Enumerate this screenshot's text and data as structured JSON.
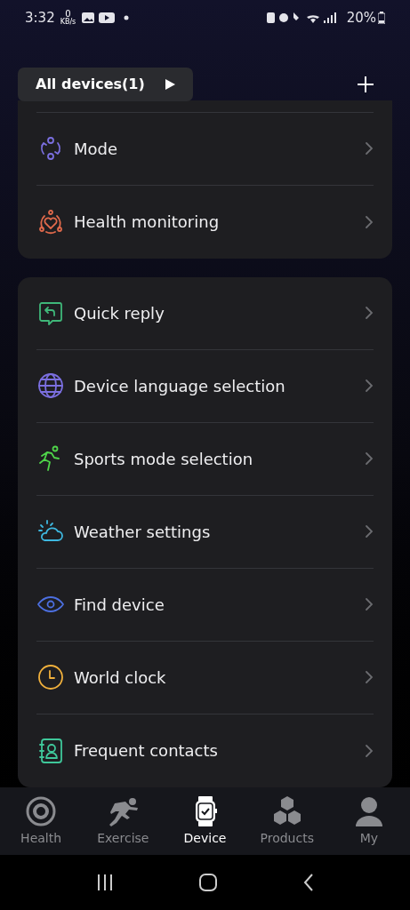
{
  "status_bar": {
    "time": "3:32",
    "net_speed": "0",
    "net_unit": "KB/s",
    "battery": "20%"
  },
  "header": {
    "devices_button": "All devices(1)"
  },
  "groups": [
    {
      "items": [
        {
          "label": "Mode"
        },
        {
          "label": "Health monitoring"
        }
      ]
    },
    {
      "items": [
        {
          "label": "Quick reply"
        },
        {
          "label": "Device language selection"
        },
        {
          "label": "Sports mode selection"
        },
        {
          "label": "Weather settings"
        },
        {
          "label": "Find device"
        },
        {
          "label": "World clock"
        },
        {
          "label": "Frequent contacts"
        }
      ]
    }
  ],
  "tabs": [
    {
      "label": "Health",
      "selected": false
    },
    {
      "label": "Exercise",
      "selected": false
    },
    {
      "label": "Device",
      "selected": true
    },
    {
      "label": "Products",
      "selected": false
    },
    {
      "label": "My",
      "selected": false
    }
  ]
}
